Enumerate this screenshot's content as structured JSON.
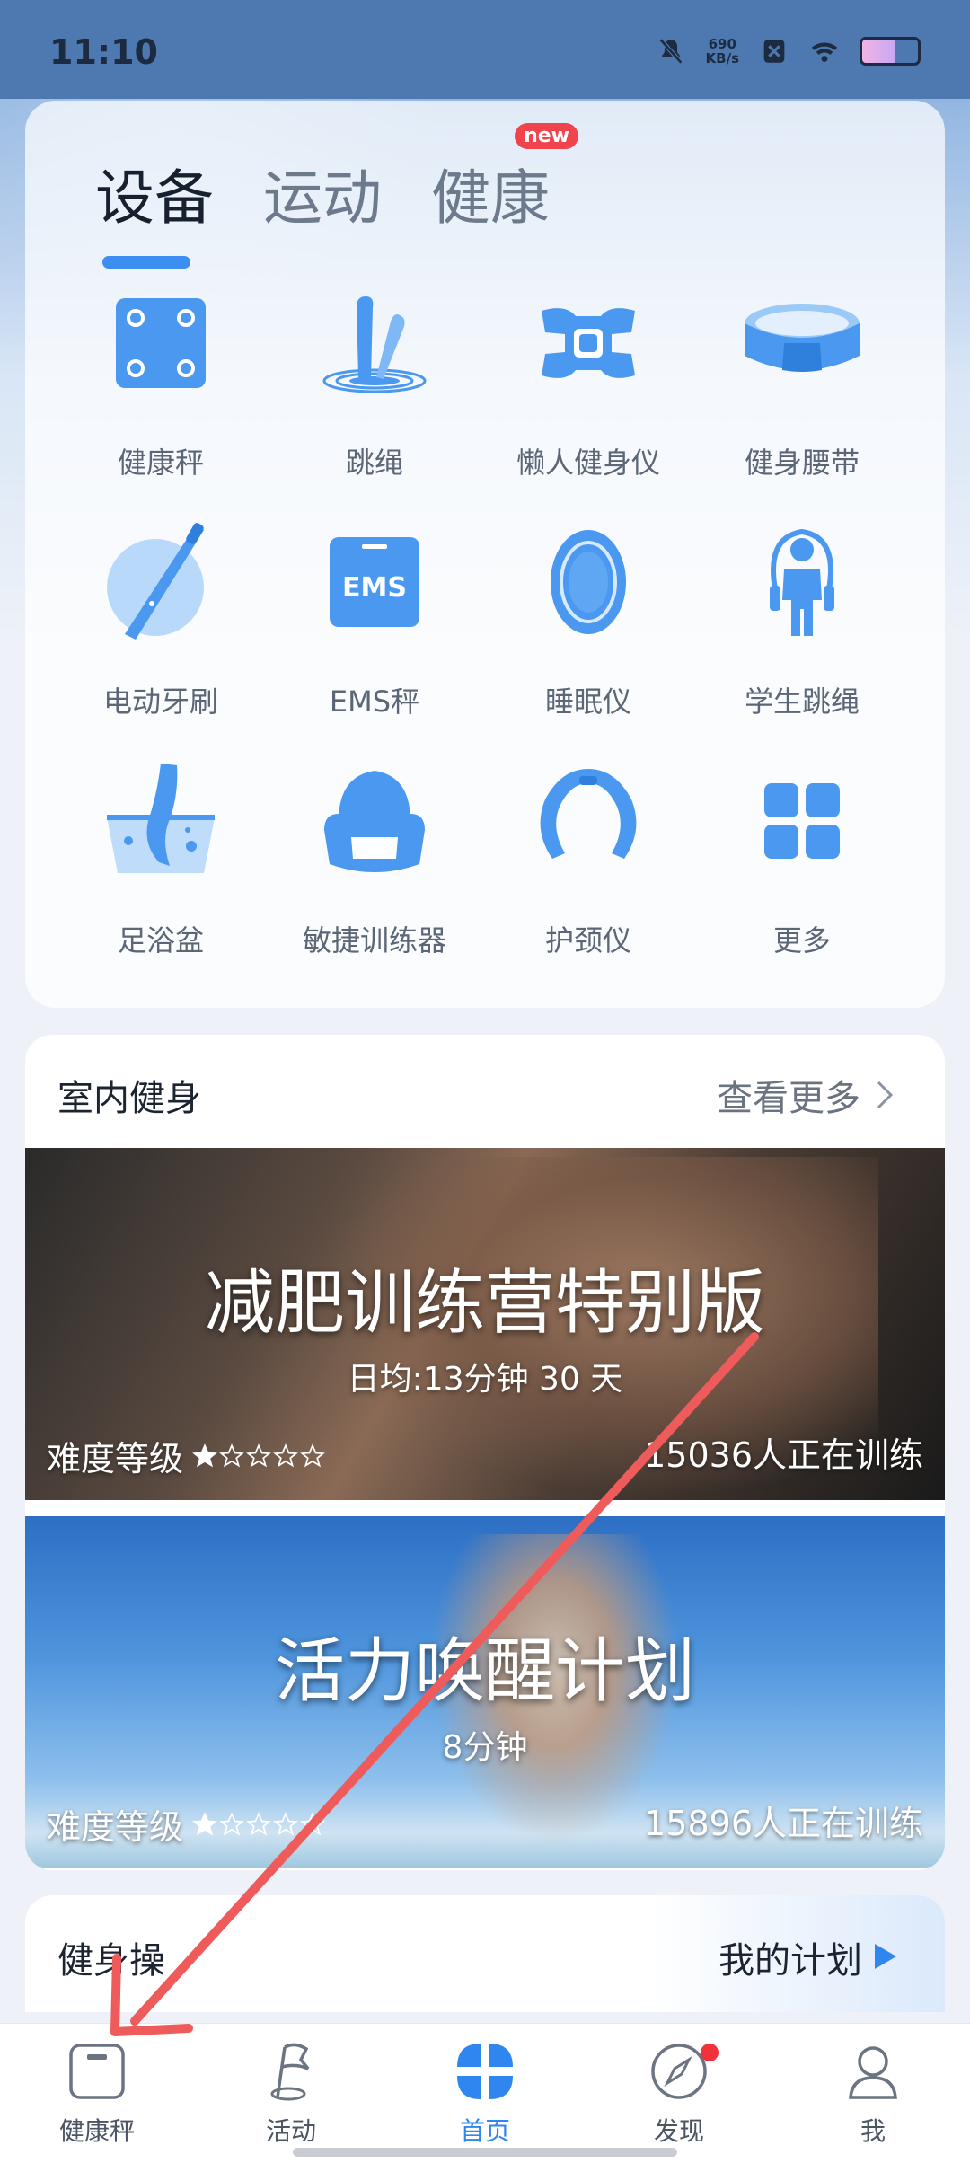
{
  "status_bar": {
    "time": "11:10",
    "net_speed_value": "690",
    "net_speed_unit": "KB/s"
  },
  "device_section": {
    "tabs": [
      {
        "label": "设备",
        "active": true
      },
      {
        "label": "运动",
        "active": false
      },
      {
        "label": "健康",
        "active": false,
        "badge": "new"
      }
    ],
    "devices": [
      {
        "label": "健康秤",
        "icon": "scale-icon"
      },
      {
        "label": "跳绳",
        "icon": "jump-rope-icon"
      },
      {
        "label": "懒人健身仪",
        "icon": "ems-pad-icon"
      },
      {
        "label": "健身腰带",
        "icon": "fitness-belt-icon"
      },
      {
        "label": "电动牙刷",
        "icon": "toothbrush-icon"
      },
      {
        "label": "EMS秤",
        "icon": "ems-scale-icon",
        "icon_text": "EMS"
      },
      {
        "label": "睡眠仪",
        "icon": "sleep-device-icon"
      },
      {
        "label": "学生跳绳",
        "icon": "student-jump-rope-icon"
      },
      {
        "label": "足浴盆",
        "icon": "foot-bath-icon"
      },
      {
        "label": "敏捷训练器",
        "icon": "agility-trainer-icon"
      },
      {
        "label": "护颈仪",
        "icon": "neck-massager-icon"
      },
      {
        "label": "更多",
        "icon": "more-grid-icon"
      }
    ]
  },
  "indoor_fitness": {
    "title": "室内健身",
    "more_label": "查看更多",
    "programs": [
      {
        "title": "减肥训练营特别版",
        "subtitle": "日均:13分钟  30 天",
        "difficulty_label": "难度等级",
        "difficulty_stars": 1,
        "max_stars": 5,
        "participants": "15036人正在训练"
      },
      {
        "title": "活力唤醒计划",
        "subtitle": "8分钟",
        "difficulty_label": "难度等级",
        "difficulty_stars": 1,
        "max_stars": 5,
        "participants": "15896人正在训练"
      }
    ]
  },
  "gym_section": {
    "title": "健身操",
    "plan_label": "我的计划"
  },
  "bottom_nav": [
    {
      "label": "健康秤",
      "icon": "scale-nav-icon",
      "active": false
    },
    {
      "label": "活动",
      "icon": "flag-nav-icon",
      "active": false
    },
    {
      "label": "首页",
      "icon": "home-grid-nav-icon",
      "active": true
    },
    {
      "label": "发现",
      "icon": "compass-nav-icon",
      "active": false,
      "has_badge": true
    },
    {
      "label": "我",
      "icon": "profile-nav-icon",
      "active": false
    }
  ],
  "colors": {
    "accent": "#3c8ef2",
    "icon_blue": "#4a98f0",
    "badge_red": "#f0434b",
    "annotation_arrow": "#ef5a5a"
  }
}
